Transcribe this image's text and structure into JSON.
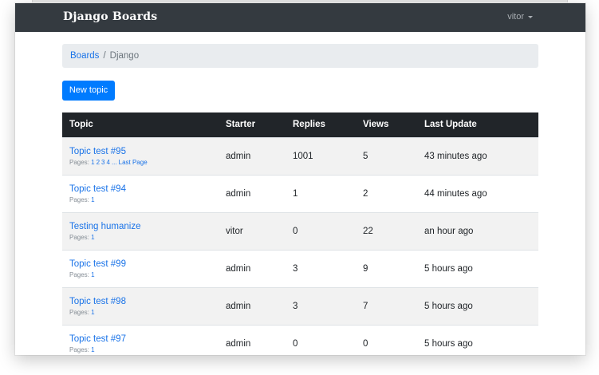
{
  "navbar": {
    "brand": "Django Boards",
    "user": "vitor"
  },
  "breadcrumb": {
    "root": "Boards",
    "separator": "/",
    "current": "Django"
  },
  "actions": {
    "new_topic": "New topic"
  },
  "table": {
    "headers": [
      "Topic",
      "Starter",
      "Replies",
      "Views",
      "Last Update"
    ],
    "rows": [
      {
        "topic": "Topic test #95",
        "pages_label": "Pages:",
        "pages": [
          "1",
          "2",
          "3",
          "4"
        ],
        "ellipsis": "...",
        "last_page": "Last Page",
        "starter": "admin",
        "replies": "1001",
        "views": "5",
        "last_update": "43 minutes ago"
      },
      {
        "topic": "Topic test #94",
        "pages_label": "Pages:",
        "pages": [
          "1"
        ],
        "starter": "admin",
        "replies": "1",
        "views": "2",
        "last_update": "44 minutes ago"
      },
      {
        "topic": "Testing humanize",
        "pages_label": "Pages:",
        "pages": [
          "1"
        ],
        "starter": "vitor",
        "replies": "0",
        "views": "22",
        "last_update": "an hour ago"
      },
      {
        "topic": "Topic test #99",
        "pages_label": "Pages:",
        "pages": [
          "1"
        ],
        "starter": "admin",
        "replies": "3",
        "views": "9",
        "last_update": "5 hours ago"
      },
      {
        "topic": "Topic test #98",
        "pages_label": "Pages:",
        "pages": [
          "1"
        ],
        "starter": "admin",
        "replies": "3",
        "views": "7",
        "last_update": "5 hours ago"
      },
      {
        "topic": "Topic test #97",
        "pages_label": "Pages:",
        "pages": [
          "1"
        ],
        "starter": "admin",
        "replies": "0",
        "views": "0",
        "last_update": "5 hours ago"
      }
    ]
  },
  "colors": {
    "navbar": "#343a40",
    "link": "#1a73e8",
    "primary_button": "#007bff",
    "table_header": "#212529",
    "stripe": "#f2f2f2",
    "breadcrumb_bg": "#e9ecef"
  }
}
